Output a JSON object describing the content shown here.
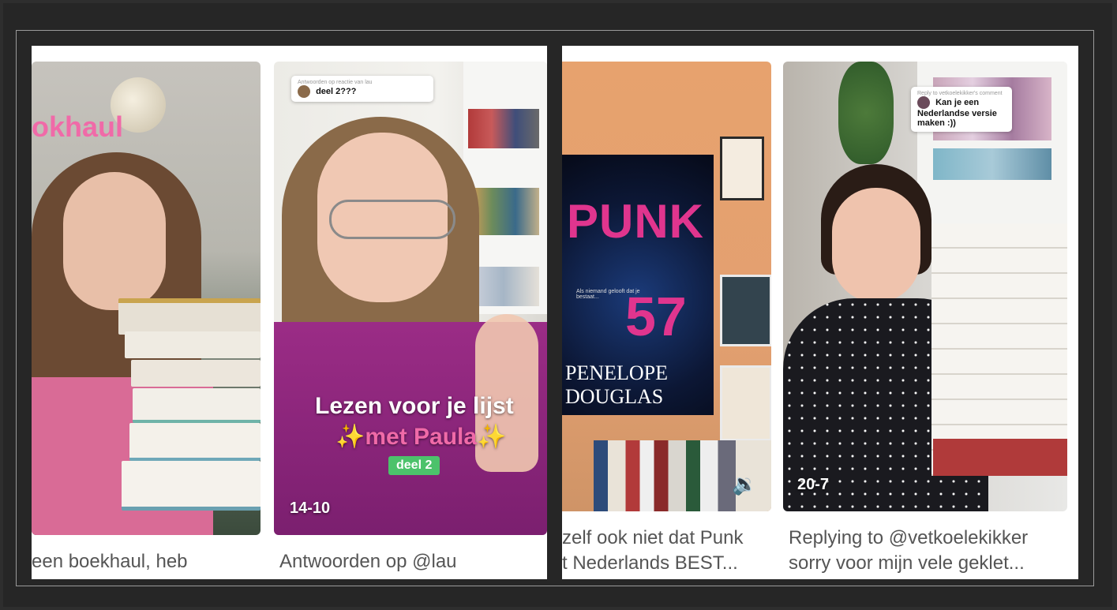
{
  "cards": [
    {
      "overlay_title": "okhaul",
      "caption": "een boekhaul, heb"
    },
    {
      "reply_bubble": {
        "sub": "Antwoorden op reactie van lau",
        "text": "deel 2???"
      },
      "overlay_line1": "Lezen voor je lijst",
      "overlay_line2": "✨met Paula✨",
      "badge": "deel 2",
      "date": "14-10",
      "caption": "Antwoorden op @lau"
    },
    {
      "book_title_line1": "PUNK",
      "book_title_line2": "57",
      "book_tagline": "Als niemand gelooft dat je bestaat...",
      "book_author_line1": "PENELOPE",
      "book_author_line2": "DOUGLAS",
      "caption_line1": "zelf ook niet dat Punk",
      "caption_line2": "t Nederlands BEST..."
    },
    {
      "reply_bubble": {
        "sub": "Reply to vetkoelekikker's comment",
        "text": "Kan je een Nederlandse versie maken :))"
      },
      "date": "20-7",
      "caption_line1": "Replying to @vetkoelekikker",
      "caption_line2": "sorry voor mijn vele geklet..."
    }
  ],
  "colors": {
    "accent_pink": "#f06aa8",
    "badge_green": "#4cc26b",
    "punk_pink": "#e0358e"
  }
}
